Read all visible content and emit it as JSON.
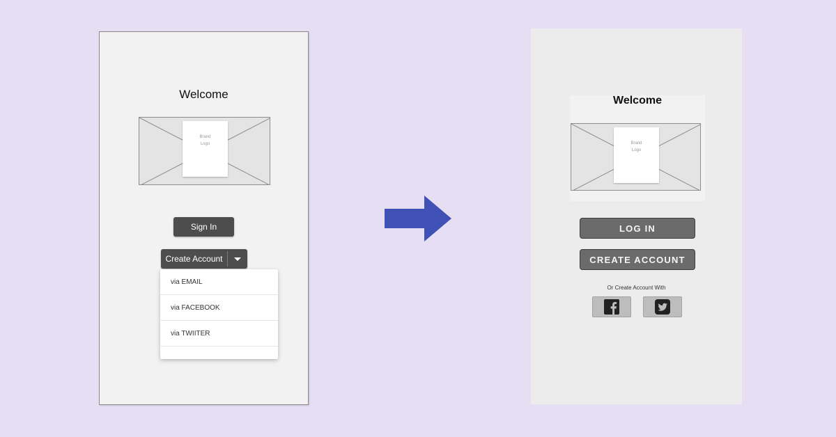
{
  "before": {
    "title": "Welcome",
    "logo_text_1": "Brand",
    "logo_text_2": "Logo",
    "sign_in_label": "Sign In",
    "create_account_label": "Create Account",
    "dropdown_items": [
      "via EMAIL",
      "via FACEBOOK",
      "via TWIITER"
    ]
  },
  "after": {
    "title": "Welcome",
    "logo_text_1": "Brand",
    "logo_text_2": "Logo",
    "login_label": "LOG IN",
    "create_account_label": "CREATE ACCOUNT",
    "social_prompt": "Or Create Account With",
    "social_buttons": [
      "facebook-icon",
      "twitter-icon"
    ]
  },
  "colors": {
    "background": "#e6def3",
    "arrow": "#3f51b5",
    "dark_button": "#4d4d4d",
    "grey_button": "#6b6b6b"
  }
}
